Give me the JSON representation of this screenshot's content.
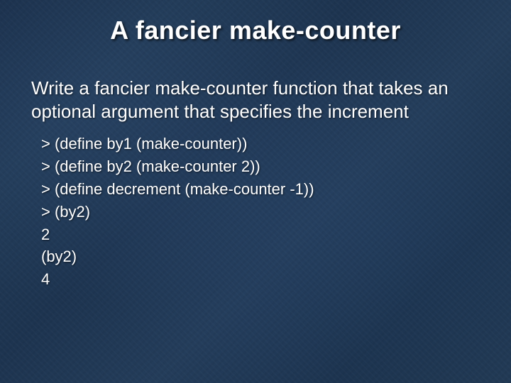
{
  "title": "A fancier make-counter",
  "lead": "Write a fancier make-counter function that takes an optional argument that specifies the increment",
  "code": [
    "> (define by1 (make-counter))",
    "> (define by2 (make-counter 2))",
    "> (define decrement (make-counter -1))",
    "> (by2)",
    "2",
    "(by2)",
    "4"
  ]
}
